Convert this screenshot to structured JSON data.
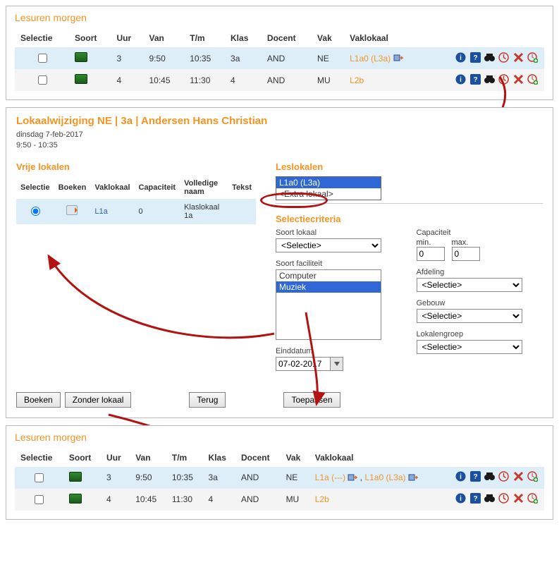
{
  "top_panel": {
    "title": "Lesuren morgen",
    "headers": [
      "Selectie",
      "Soort",
      "Uur",
      "Van",
      "T/m",
      "Klas",
      "Docent",
      "Vak",
      "Vaklokaal"
    ],
    "rows": [
      {
        "uur": "3",
        "van": "9:50",
        "tm": "10:35",
        "klas": "3a",
        "docent": "AND",
        "vak": "NE",
        "vaklokaal": "L1a0 (L3a)"
      },
      {
        "uur": "4",
        "van": "10:45",
        "tm": "11:30",
        "klas": "4",
        "docent": "AND",
        "vak": "MU",
        "vaklokaal": "L2b"
      }
    ]
  },
  "edit_panel": {
    "title": "Lokaalwijziging NE |  3a |  Andersen Hans Christian",
    "date_line": "dinsdag 7-feb-2017",
    "time_line": "9:50 - 10:35",
    "vrije_title": "Vrije lokalen",
    "vrije_headers": [
      "Selectie",
      "Boeken",
      "Vaklokaal",
      "Capaciteit",
      "Volledige naam",
      "Tekst"
    ],
    "vrije_row": {
      "vaklokaal": "L1a",
      "capaciteit": "0",
      "naam": "Klaslokaal 1a",
      "tekst": ""
    },
    "leslokalen_title": "Leslokalen",
    "leslokalen_opts": [
      "L1a0 (L3a)",
      "<Extra lokaal>"
    ],
    "criteria_title": "Selectiecriteria",
    "labels": {
      "soort_lokaal": "Soort lokaal",
      "soort_faciliteit": "Soort faciliteit",
      "einddatum": "Einddatum",
      "capaciteit": "Capaciteit",
      "min": "min.",
      "max": "max.",
      "afdeling": "Afdeling",
      "gebouw": "Gebouw",
      "lokalengroep": "Lokalengroep"
    },
    "select_placeholder": "<Selectie>",
    "faciliteit_opts": [
      "Computer",
      "Muziek"
    ],
    "einddatum_value": "07-02-2017",
    "cap_min": "0",
    "cap_max": "0",
    "buttons": {
      "boeken": "Boeken",
      "zonder": "Zonder lokaal",
      "terug": "Terug",
      "toepassen": "Toepassen"
    }
  },
  "bottom_panel": {
    "title": "Lesuren morgen",
    "headers": [
      "Selectie",
      "Soort",
      "Uur",
      "Van",
      "T/m",
      "Klas",
      "Docent",
      "Vak",
      "Vaklokaal"
    ],
    "rows": [
      {
        "uur": "3",
        "van": "9:50",
        "tm": "10:35",
        "klas": "3a",
        "docent": "AND",
        "vak": "NE",
        "vaklokaal_a": "L1a (---)",
        "vaklokaal_b": "L1a0 (L3a)"
      },
      {
        "uur": "4",
        "van": "10:45",
        "tm": "11:30",
        "klas": "4",
        "docent": "AND",
        "vak": "MU",
        "vaklokaal": "L2b"
      }
    ]
  }
}
